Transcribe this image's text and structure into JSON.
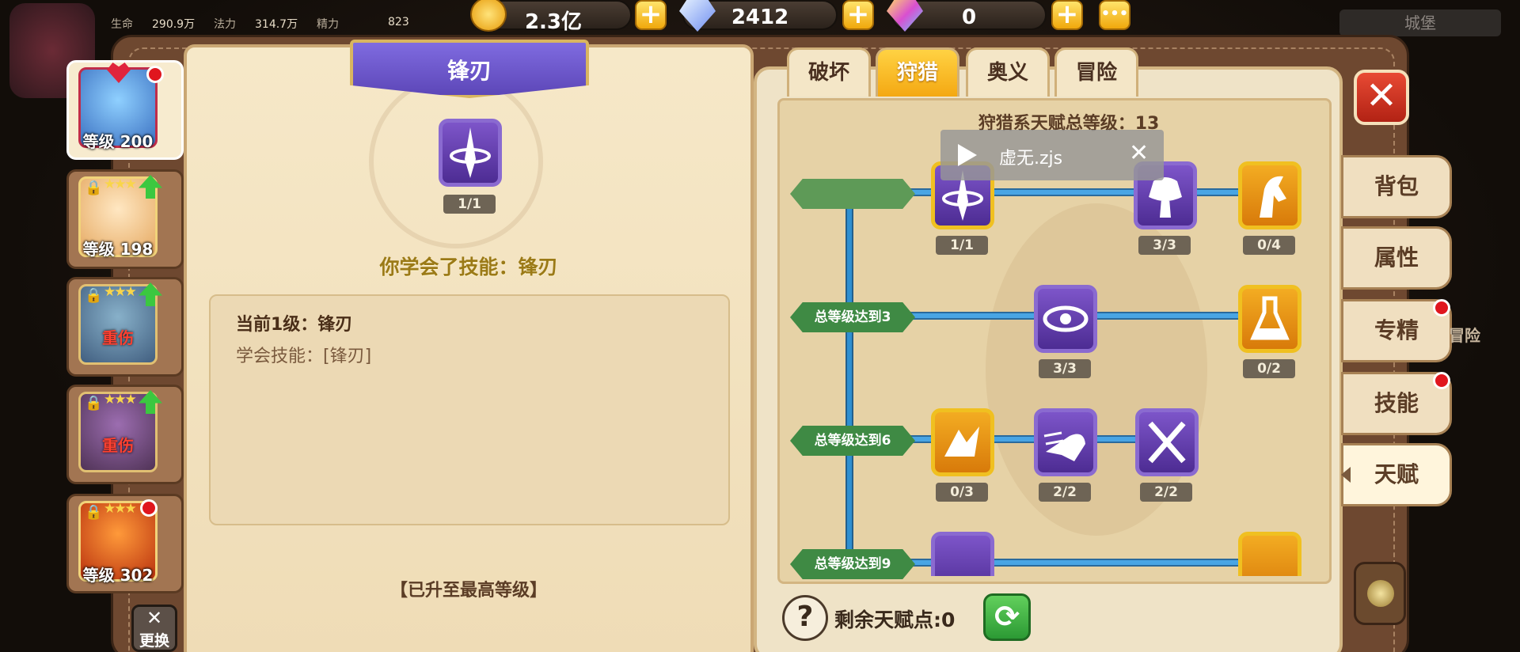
{
  "hud": {
    "hp_label": "生命",
    "hp_value": "290.9万",
    "mp_label": "法力",
    "mp_value": "314.7万",
    "sp_label": "精力",
    "sp_value": "823",
    "gold": "2.3亿",
    "diamonds": "2412",
    "gems": "0",
    "plus": "+",
    "more": "•••",
    "city_label": "城堡"
  },
  "heroes": [
    {
      "level": "等级 200",
      "selected": true
    },
    {
      "level": "等级 198"
    },
    {
      "status": "重伤"
    },
    {
      "status": "重伤"
    },
    {
      "level": "等级 302"
    }
  ],
  "swap_label": "更换",
  "skill_detail": {
    "title": "锋刃",
    "level": "1/1",
    "learned": "你学会了技能：锋刃",
    "desc_line1": "当前1级：锋刃",
    "desc_line2": "学会技能：[锋刃]",
    "maxed": "【已升至最高等级】"
  },
  "tabs": [
    "破坏",
    "狩猎",
    "奥义",
    "冒险"
  ],
  "active_tab": "狩猎",
  "tree": {
    "summary": "狩猎系天赋总等级：13",
    "tier_labels": [
      "总等级达到3",
      "总等级达到6",
      "总等级达到9"
    ],
    "nodes": [
      {
        "id": "blade",
        "level": "1/1"
      },
      {
        "id": "strength",
        "level": "3/3"
      },
      {
        "id": "horse",
        "level": "0/4"
      },
      {
        "id": "eye",
        "level": "3/3"
      },
      {
        "id": "flask",
        "level": "0/2"
      },
      {
        "id": "break",
        "level": "0/3"
      },
      {
        "id": "charge",
        "level": "2/2"
      },
      {
        "id": "daggers",
        "level": "2/2"
      }
    ],
    "remaining": "剩余天赋点:0"
  },
  "popup": {
    "text": "虚无.zjs",
    "close": "✕"
  },
  "side_tabs": [
    "背包",
    "属性",
    "专精",
    "技能",
    "天赋"
  ],
  "active_side_tab": "天赋",
  "side_other": "冒险",
  "close_label": "✕",
  "help_label": "?",
  "refresh_label": "⟳"
}
